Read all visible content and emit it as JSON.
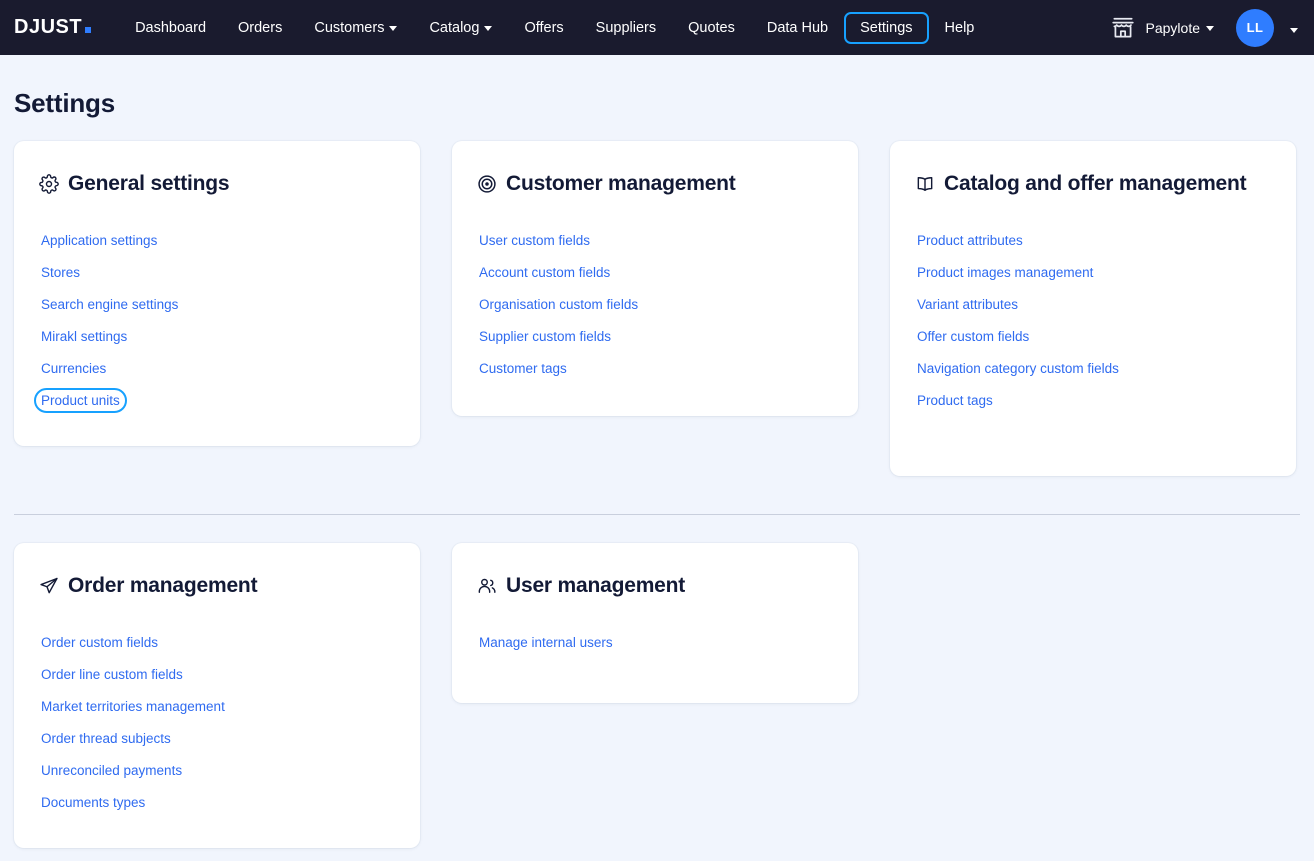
{
  "header": {
    "logo_text": "DJUST",
    "nav_items": [
      {
        "label": "Dashboard",
        "has_caret": false,
        "focused": false
      },
      {
        "label": "Orders",
        "has_caret": false,
        "focused": false
      },
      {
        "label": "Customers",
        "has_caret": true,
        "focused": false
      },
      {
        "label": "Catalog",
        "has_caret": true,
        "focused": false
      },
      {
        "label": "Offers",
        "has_caret": false,
        "focused": false
      },
      {
        "label": "Suppliers",
        "has_caret": false,
        "focused": false
      },
      {
        "label": "Quotes",
        "has_caret": false,
        "focused": false
      },
      {
        "label": "Data Hub",
        "has_caret": false,
        "focused": false
      },
      {
        "label": "Settings",
        "has_caret": false,
        "focused": true
      },
      {
        "label": "Help",
        "has_caret": false,
        "focused": false
      }
    ],
    "store_icon": "storefront-icon",
    "store_name": "Papylote",
    "avatar_initials": "LL",
    "accent_color": "#2f7dff",
    "focus_ring_color": "#17a1ff",
    "bar_color": "#1a1b2e"
  },
  "page": {
    "title": "Settings"
  },
  "cards": {
    "general": {
      "icon": "gear-icon",
      "title": "General settings",
      "links": [
        {
          "label": "Application settings",
          "focused": false
        },
        {
          "label": "Stores",
          "focused": false
        },
        {
          "label": "Search engine settings",
          "focused": false
        },
        {
          "label": "Mirakl settings",
          "focused": false
        },
        {
          "label": "Currencies",
          "focused": false
        },
        {
          "label": "Product units",
          "focused": true
        }
      ]
    },
    "customer": {
      "icon": "target-icon",
      "title": "Customer management",
      "links": [
        {
          "label": "User custom fields",
          "focused": false
        },
        {
          "label": "Account custom fields",
          "focused": false
        },
        {
          "label": "Organisation custom fields",
          "focused": false
        },
        {
          "label": "Supplier custom fields",
          "focused": false
        },
        {
          "label": "Customer tags",
          "focused": false
        }
      ]
    },
    "catalog": {
      "icon": "book-icon",
      "title": "Catalog and offer management",
      "links": [
        {
          "label": "Product attributes",
          "focused": false
        },
        {
          "label": "Product images management",
          "focused": false
        },
        {
          "label": "Variant attributes",
          "focused": false
        },
        {
          "label": "Offer custom fields",
          "focused": false
        },
        {
          "label": "Navigation category custom fields",
          "focused": false
        },
        {
          "label": "Product tags",
          "focused": false
        }
      ]
    },
    "order": {
      "icon": "send-icon",
      "title": "Order management",
      "links": [
        {
          "label": "Order custom fields",
          "focused": false
        },
        {
          "label": "Order line custom fields",
          "focused": false
        },
        {
          "label": "Market territories management",
          "focused": false
        },
        {
          "label": "Order thread subjects",
          "focused": false
        },
        {
          "label": "Unreconciled payments",
          "focused": false
        },
        {
          "label": "Documents types",
          "focused": false
        }
      ]
    },
    "user": {
      "icon": "users-icon",
      "title": "User management",
      "links": [
        {
          "label": "Manage internal users",
          "focused": false
        }
      ]
    }
  }
}
